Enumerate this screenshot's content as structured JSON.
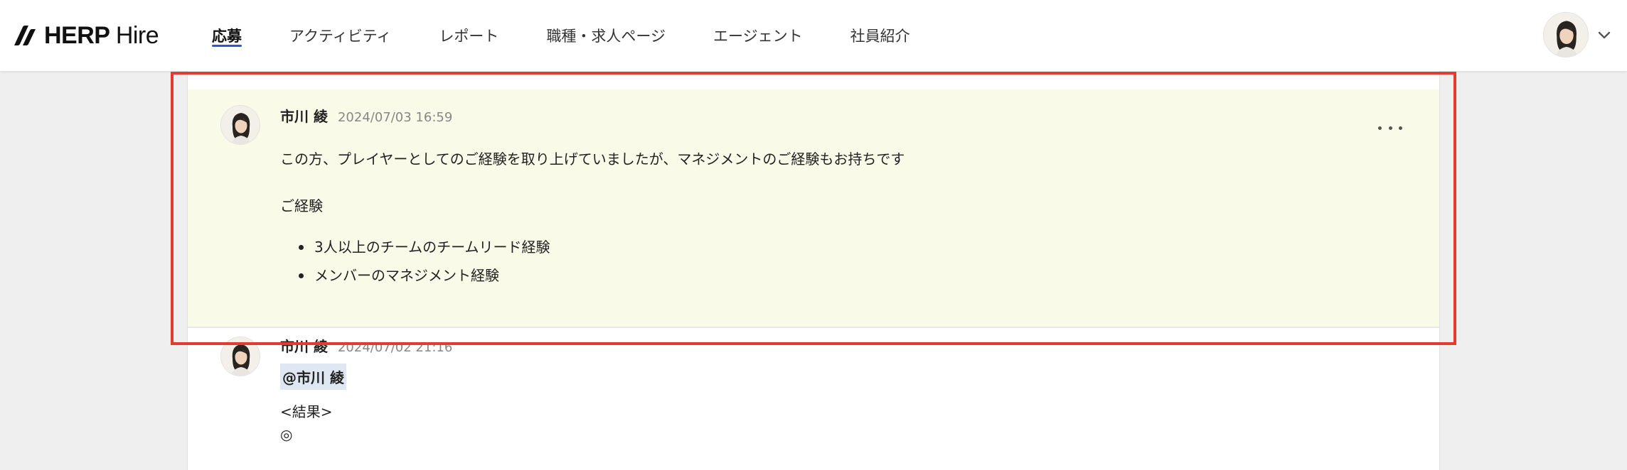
{
  "brand": {
    "logo_text_bold": "HERP",
    "logo_text_rest": "Hire"
  },
  "nav": {
    "items": [
      {
        "label": "応募",
        "active": true
      },
      {
        "label": "アクティビティ",
        "active": false
      },
      {
        "label": "レポート",
        "active": false
      },
      {
        "label": "職種・求人ページ",
        "active": false
      },
      {
        "label": "エージェント",
        "active": false
      },
      {
        "label": "社員紹介",
        "active": false
      }
    ]
  },
  "colors": {
    "accent": "#2f55d4",
    "highlight_bg": "#fafae8",
    "frame": "#e43a2f",
    "mention_bg": "#dfe7f2"
  },
  "comments": [
    {
      "author": "市川 綾",
      "timestamp": "2024/07/03 16:59",
      "paragraph": "この方、プレイヤーとしてのご経験を取り上げていましたが、マネジメントのご経験もお持ちです",
      "subheading": "ご経験",
      "bullets": [
        "3人以上のチームのチームリード経験",
        "メンバーのマネジメント経験"
      ],
      "menu_icon": "more-horizontal-icon"
    },
    {
      "author": "市川 綾",
      "timestamp": "2024/07/02 21:16",
      "mention": "@市川 綾",
      "line1": "<結果>",
      "line2": "◎"
    }
  ]
}
